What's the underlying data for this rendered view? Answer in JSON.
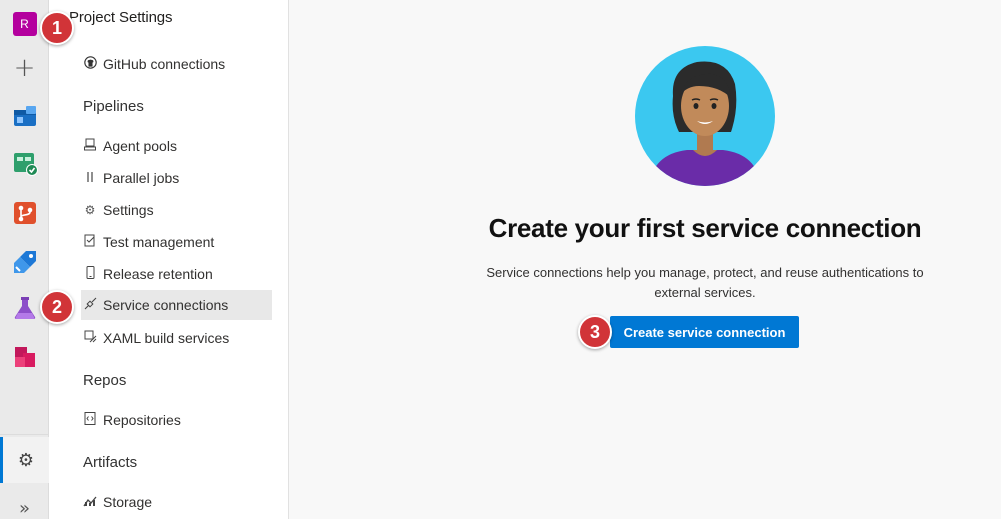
{
  "rail": {
    "org_initial": "R",
    "items": [
      {
        "name": "overview",
        "icon": "overview-icon"
      },
      {
        "name": "boards",
        "icon": "boards-icon"
      },
      {
        "name": "repos",
        "icon": "repos-icon"
      },
      {
        "name": "pipelines",
        "icon": "pipelines-icon"
      },
      {
        "name": "test-plans",
        "icon": "test-plans-icon"
      },
      {
        "name": "artifacts",
        "icon": "artifacts-icon"
      }
    ]
  },
  "nav": {
    "title": "Project Settings",
    "items_top": [
      {
        "label": "GitHub connections",
        "icon": "github-icon"
      }
    ],
    "sections": [
      {
        "title": "Pipelines",
        "items": [
          {
            "label": "Agent pools",
            "icon": "agent-pools-icon"
          },
          {
            "label": "Parallel jobs",
            "icon": "parallel-jobs-icon"
          },
          {
            "label": "Settings",
            "icon": "gear-icon"
          },
          {
            "label": "Test management",
            "icon": "test-management-icon"
          },
          {
            "label": "Release retention",
            "icon": "phone-icon"
          },
          {
            "label": "Service connections",
            "icon": "plug-icon",
            "active": true
          },
          {
            "label": "XAML build services",
            "icon": "build-icon"
          }
        ]
      },
      {
        "title": "Repos",
        "items": [
          {
            "label": "Repositories",
            "icon": "repo-icon"
          }
        ]
      },
      {
        "title": "Artifacts",
        "items": [
          {
            "label": "Storage",
            "icon": "storage-icon"
          }
        ]
      }
    ]
  },
  "main": {
    "headline": "Create your first service connection",
    "description": "Service connections help you manage, protect, and reuse authentications to external services.",
    "cta_label": "Create service connection"
  },
  "markers": [
    "1",
    "2",
    "3"
  ],
  "colors": {
    "accent": "#0078d4",
    "marker": "#d13438",
    "org_avatar": "#b4009e"
  }
}
